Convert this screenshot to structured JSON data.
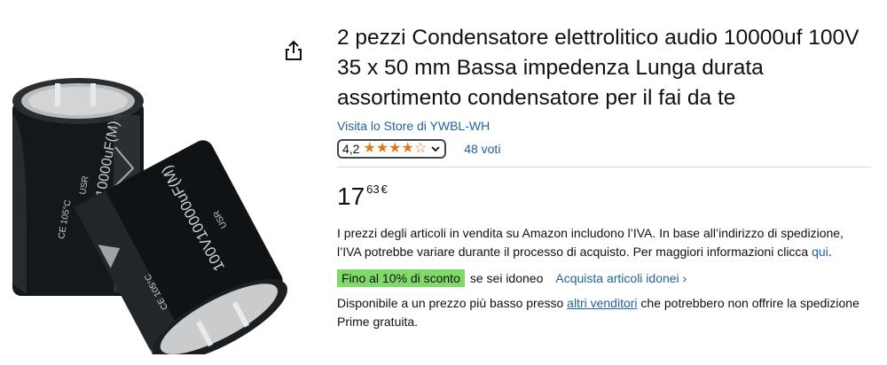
{
  "product": {
    "title": "2 pezzi Condensatore elettrolitico audio 10000uf 100V 35 x 50 mm Bassa impedenza Lunga durata assortimento condensatore per il fai da te",
    "store_link": "Visita lo Store di YWBL-WH",
    "rating": {
      "value": "4,2",
      "stars_out_of_5": 4.2,
      "votes": "48 voti"
    },
    "price": {
      "whole": "17",
      "fraction": "63",
      "currency": "€"
    },
    "vat_notice": {
      "text": "I prezzi degli articoli in vendita su Amazon includono l’IVA. In base all’indirizzo di spedizione, l’IVA potrebbe variare durante il processo di acquisto. Per maggiori informazioni clicca ",
      "link": "qui",
      "after": "."
    },
    "discount": {
      "badge": "Fino al 10% di sconto",
      "after": "se sei idoneo",
      "link": "Acquista articoli idonei ›"
    },
    "availability": {
      "before": "Disponibile a un prezzo più basso presso ",
      "link": "altri venditori",
      "after": " che potrebbero non offrire la spedizione Prime gratuita."
    }
  },
  "image": {
    "label_front": "100V10000uF(M)",
    "label_back": "100V10000uF(M)",
    "print_ce": "CE 105°C",
    "print_usr": "USR"
  },
  "colors": {
    "link": "#2162a1",
    "star": "#de7921",
    "discount_bg": "#7fda69",
    "text": "#0f1111"
  },
  "icons": [
    "share-icon",
    "star-icon",
    "chevron-down-icon"
  ]
}
